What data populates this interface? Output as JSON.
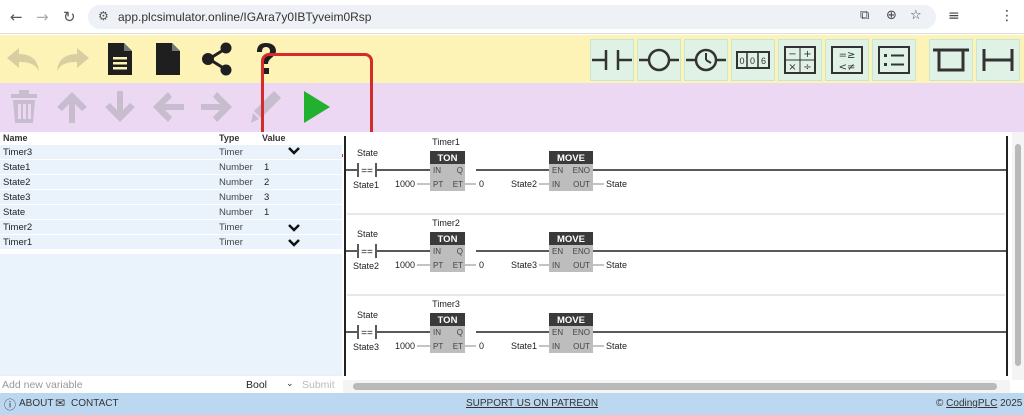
{
  "browser": {
    "url": "app.plcsimulator.online/IGAra7y0IBTyveim0Rsp"
  },
  "toolbar_top": {
    "actions": [
      "undo",
      "redo",
      "new-file",
      "blank-file",
      "share",
      "help"
    ],
    "instructions": [
      "contact",
      "coil",
      "timer",
      "counter",
      "math",
      "compare",
      "move",
      "branch-box",
      "branch-line"
    ]
  },
  "toolbar_bottom": {
    "actions": [
      "delete",
      "move-up",
      "move-down",
      "move-left",
      "move-right",
      "edit",
      "run"
    ]
  },
  "variables": {
    "headers": {
      "name": "Name",
      "type": "Type",
      "value": "Value"
    },
    "rows": [
      {
        "name": "Timer3",
        "type": "Timer",
        "value": ""
      },
      {
        "name": "State1",
        "type": "Number",
        "value": "1"
      },
      {
        "name": "State2",
        "type": "Number",
        "value": "2"
      },
      {
        "name": "State3",
        "type": "Number",
        "value": "3"
      },
      {
        "name": "State",
        "type": "Number",
        "value": "1"
      },
      {
        "name": "Timer2",
        "type": "Timer",
        "value": ""
      },
      {
        "name": "Timer1",
        "type": "Timer",
        "value": ""
      }
    ],
    "add": {
      "placeholder": "Add new variable",
      "type_selected": "Bool",
      "submit": "Submit"
    }
  },
  "ladder": {
    "rungs": [
      {
        "contact_top": "State",
        "contact_op": "==",
        "contact_bottom": "State1",
        "timer_name": "Timer1",
        "timer_type": "TON",
        "timer_in": "IN",
        "timer_q": "Q",
        "timer_pt": "PT",
        "timer_et": "ET",
        "pt_value": "1000",
        "et_value": "0",
        "move_title": "MOVE",
        "move_en": "EN",
        "move_eno": "ENO",
        "move_in": "IN",
        "move_out": "OUT",
        "move_src": "State2",
        "move_dst": "State"
      },
      {
        "contact_top": "State",
        "contact_op": "==",
        "contact_bottom": "State2",
        "timer_name": "Timer2",
        "timer_type": "TON",
        "timer_in": "IN",
        "timer_q": "Q",
        "timer_pt": "PT",
        "timer_et": "ET",
        "pt_value": "1000",
        "et_value": "0",
        "move_title": "MOVE",
        "move_en": "EN",
        "move_eno": "ENO",
        "move_in": "IN",
        "move_out": "OUT",
        "move_src": "State3",
        "move_dst": "State"
      },
      {
        "contact_top": "State",
        "contact_op": "==",
        "contact_bottom": "State3",
        "timer_name": "Timer3",
        "timer_type": "TON",
        "timer_in": "IN",
        "timer_q": "Q",
        "timer_pt": "PT",
        "timer_et": "ET",
        "pt_value": "1000",
        "et_value": "0",
        "move_title": "MOVE",
        "move_en": "EN",
        "move_eno": "ENO",
        "move_in": "IN",
        "move_out": "OUT",
        "move_src": "State1",
        "move_dst": "State"
      }
    ]
  },
  "footer": {
    "about": "ABOUT",
    "contact": "CONTACT",
    "patreon": "SUPPORT US ON PATREON",
    "copyright_prefix": "©",
    "copyright_link": "CodingPLC",
    "copyright_year": "2025"
  },
  "colors": {
    "toolbar_top_bg": "#fef3b7",
    "toolbar_bottom_bg": "#ecd8f3",
    "instruction_bg": "#dff2e5",
    "run_green": "#22b02f",
    "highlight_red": "#d62b2b",
    "footer_bg": "#bcd8f0"
  }
}
